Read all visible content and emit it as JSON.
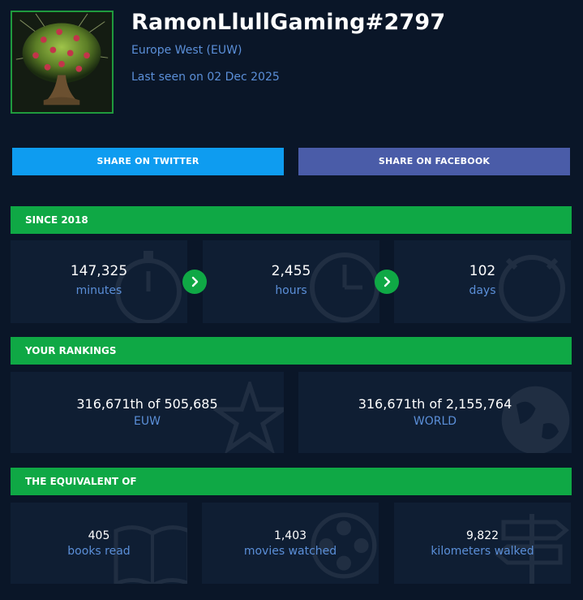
{
  "profile": {
    "name": "RamonLlullGaming#2797",
    "region": "Europe West (EUW)",
    "last_seen": "Last seen on 02 Dec 2025"
  },
  "share": {
    "twitter_label": "SHARE ON TWITTER",
    "facebook_label": "SHARE ON FACEBOOK"
  },
  "since": {
    "title": "SINCE 2018",
    "items": [
      {
        "value": "147,325",
        "unit": "minutes"
      },
      {
        "value": "2,455",
        "unit": "hours"
      },
      {
        "value": "102",
        "unit": "days"
      }
    ]
  },
  "rankings": {
    "title": "YOUR RANKINGS",
    "items": [
      {
        "value": "316,671th of 505,685",
        "unit": "EUW"
      },
      {
        "value": "316,671th of 2,155,764",
        "unit": "WORLD"
      }
    ]
  },
  "equivalent": {
    "title": "THE EQUIVALENT OF",
    "items": [
      {
        "value": "405",
        "unit": "books read"
      },
      {
        "value": "1,403",
        "unit": "movies watched"
      },
      {
        "value": "9,822",
        "unit": "kilometers walked"
      }
    ]
  },
  "colors": {
    "background": "#0a1628",
    "accent_green": "#0fa845",
    "twitter_blue": "#0e9cf0",
    "facebook_blue": "#4a5ca8",
    "link_blue": "#5b8fd8",
    "card_bg": "#0f1e33"
  },
  "icons": {
    "avatar": "summoner-icon-tree",
    "arrow": "chevron-right-icon",
    "minutes_bg": "stopwatch-icon",
    "hours_bg": "clock-icon",
    "days_bg": "calendar-icon",
    "euw_bg": "star-icon",
    "world_bg": "globe-icon",
    "books_bg": "book-icon",
    "movies_bg": "film-reel-icon",
    "walk_bg": "signpost-icon"
  }
}
